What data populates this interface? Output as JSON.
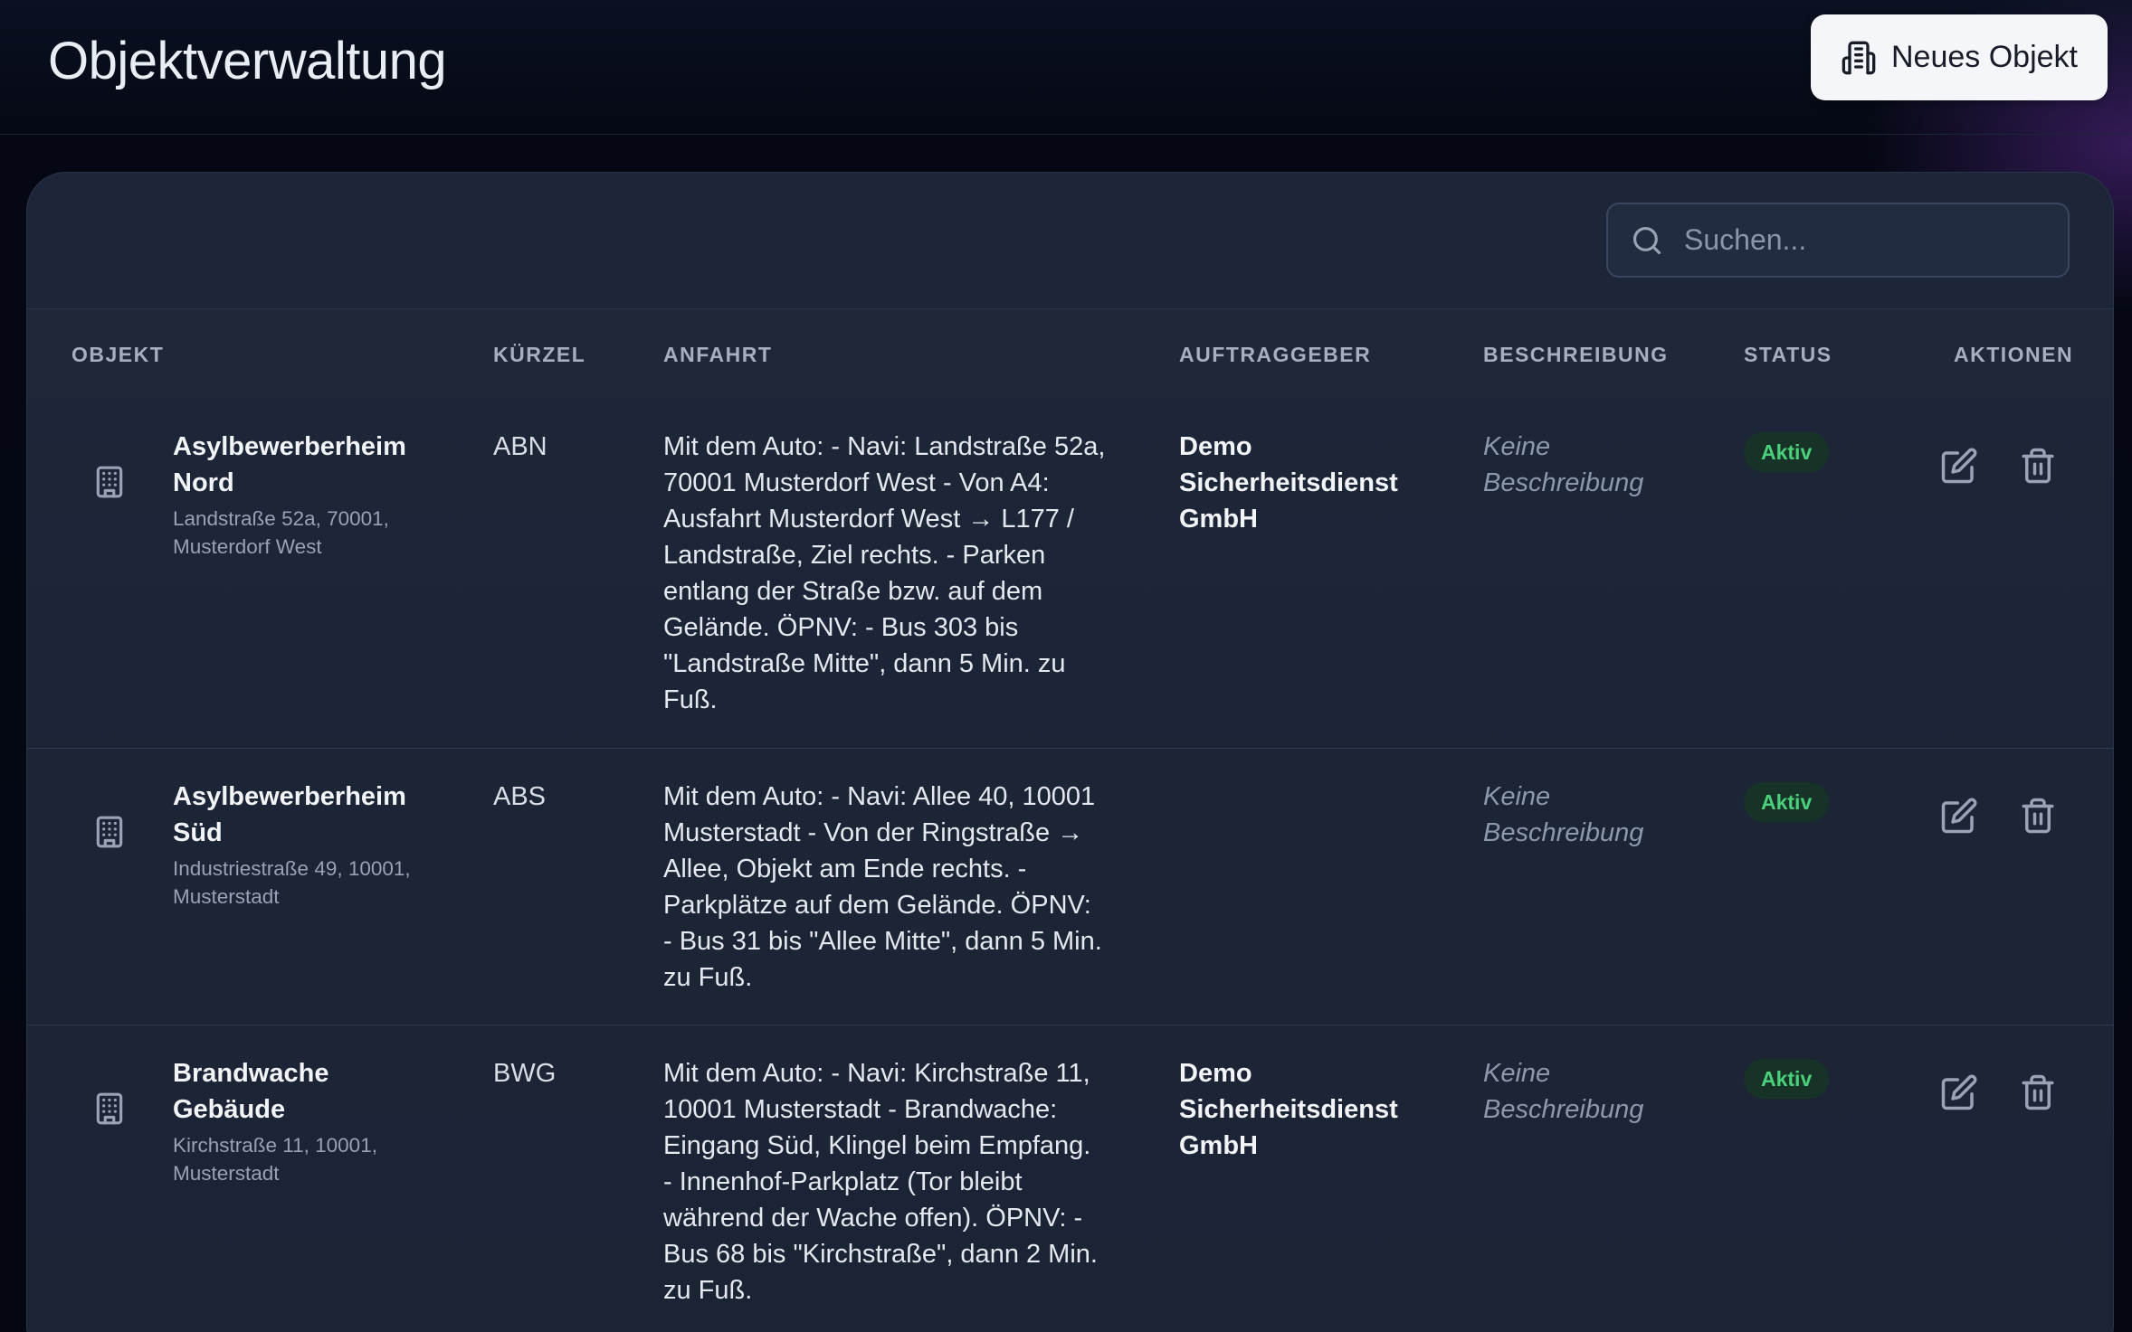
{
  "header": {
    "title": "Objektverwaltung",
    "new_button_label": "Neues Objekt"
  },
  "search": {
    "placeholder": "Suchen...",
    "value": ""
  },
  "table": {
    "columns": {
      "objekt": "OBJEKT",
      "kuerzel": "KÜRZEL",
      "anfahrt": "ANFAHRT",
      "auftraggeber": "AUFTRAGGEBER",
      "beschreibung": "BESCHREIBUNG",
      "status": "STATUS",
      "aktionen": "AKTIONEN"
    },
    "rows": [
      {
        "name": "Asylbewerberheim Nord",
        "address": "Landstraße 52a, 70001, Musterdorf West",
        "kuerzel": "ABN",
        "anfahrt": "Mit dem Auto: - Navi: Landstraße 52a, 70001 Musterdorf West - Von A4: Ausfahrt Musterdorf West → L177 / Landstraße, Ziel rechts. - Parken entlang der Straße bzw. auf dem Gelände. ÖPNV: - Bus 303 bis \"Landstraße Mitte\", dann 5 Min. zu Fuß.",
        "auftraggeber": "Demo Sicherheitsdienst GmbH",
        "beschreibung": "Keine Beschreibung",
        "status": "Aktiv"
      },
      {
        "name": "Asylbewerberheim Süd",
        "address": "Industriestraße 49, 10001, Musterstadt",
        "kuerzel": "ABS",
        "anfahrt": "Mit dem Auto: - Navi: Allee 40, 10001 Musterstadt - Von der Ringstraße → Allee, Objekt am Ende rechts. - Parkplätze auf dem Gelände. ÖPNV: - Bus 31 bis \"Allee Mitte\", dann 5 Min. zu Fuß.",
        "auftraggeber": "",
        "beschreibung": "Keine Beschreibung",
        "status": "Aktiv"
      },
      {
        "name": "Brandwache Gebäude",
        "address": "Kirchstraße 11, 10001, Musterstadt",
        "kuerzel": "BWG",
        "anfahrt": "Mit dem Auto: - Navi: Kirchstraße 11, 10001 Musterstadt - Brandwache: Eingang Süd, Klingel beim Empfang. - Innenhof-Parkplatz (Tor bleibt während der Wache offen). ÖPNV: - Bus 68 bis \"Kirchstraße\", dann 2 Min. zu Fuß.",
        "auftraggeber": "Demo Sicherheitsdienst GmbH",
        "beschreibung": "Keine Beschreibung",
        "status": "Aktiv"
      }
    ]
  },
  "colors": {
    "accent_green": "#4ad07a",
    "badge_bg": "#173327",
    "panel_bg": "#1d2638",
    "page_bg": "#040712"
  },
  "icons": {
    "new_button": "building-plus-icon",
    "search": "search-icon",
    "row": "building-icon",
    "edit": "edit-icon",
    "delete": "trash-icon"
  }
}
